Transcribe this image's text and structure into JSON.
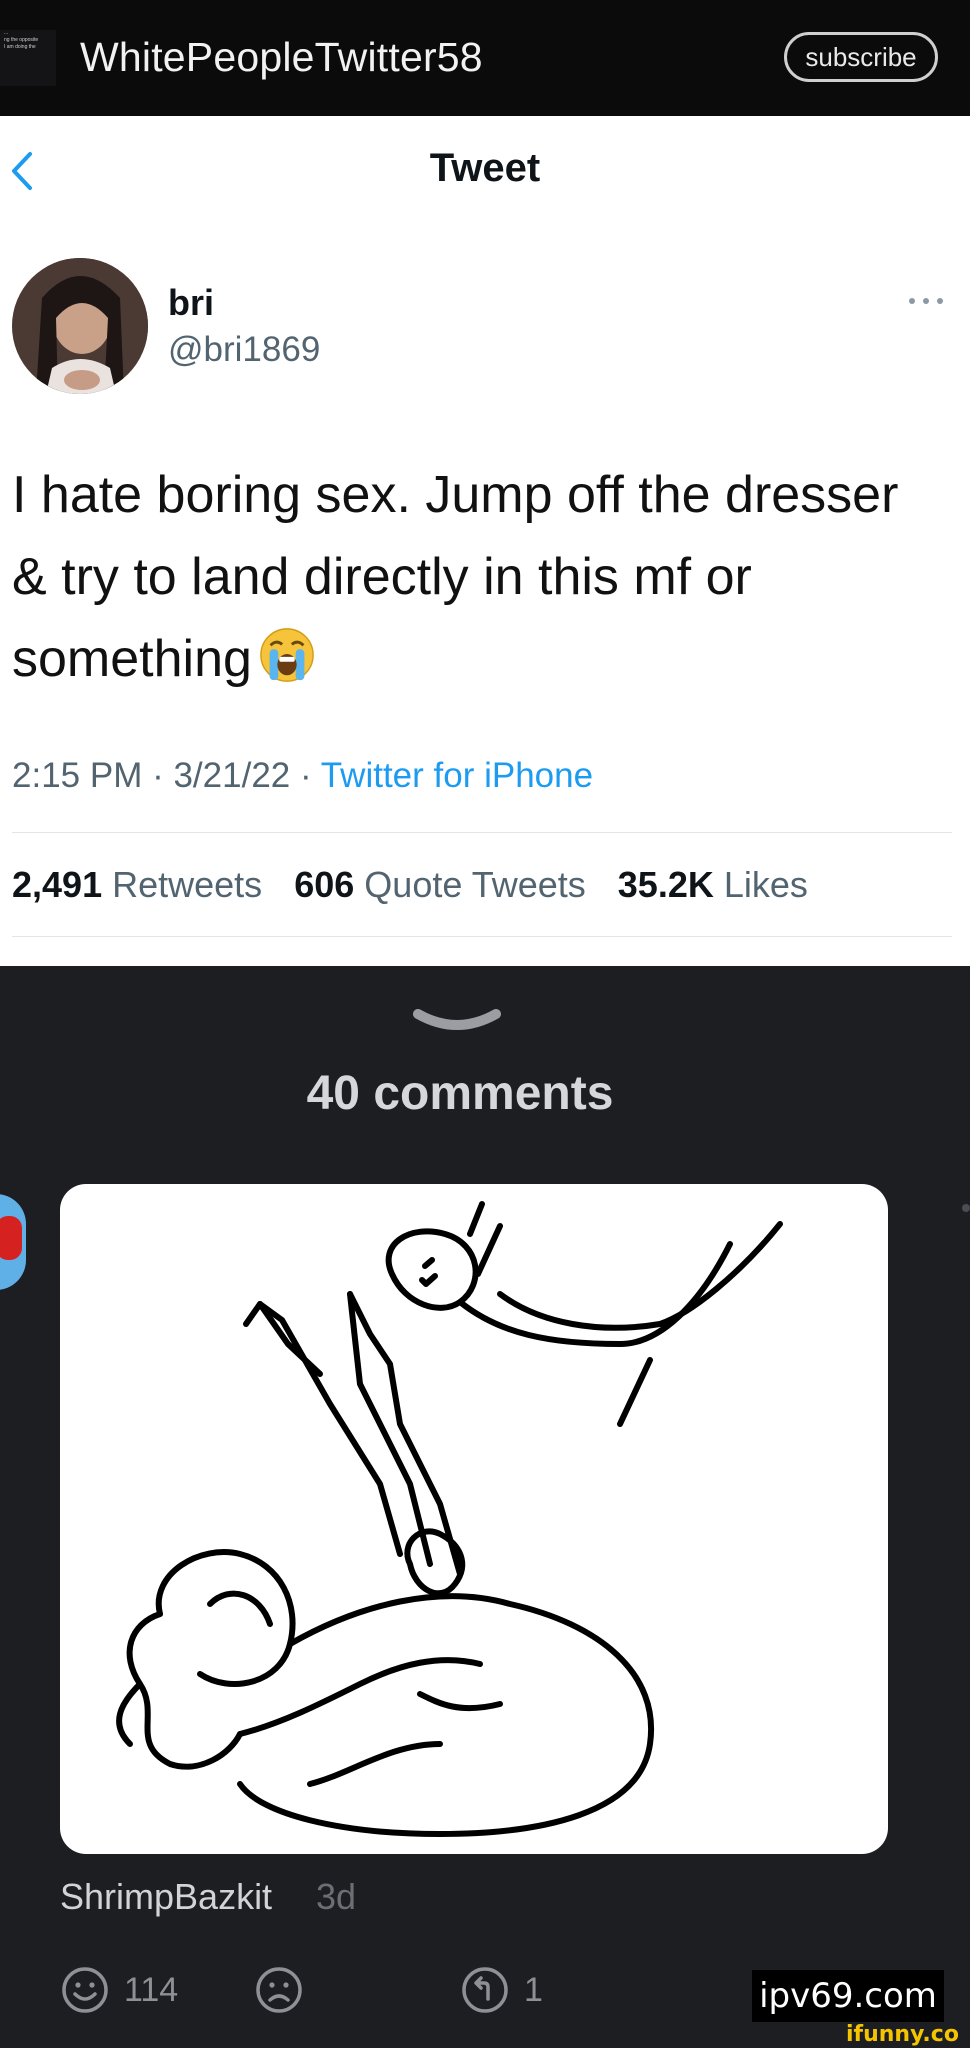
{
  "topbar": {
    "subreddit_name": "WhitePeopleTwitter58",
    "subscribe_label": "subscribe",
    "icon_thumbnail_lines": [
      "...",
      "ng the opposite",
      "I am doing the"
    ]
  },
  "tweet": {
    "header_title": "Tweet",
    "display_name": "bri",
    "handle": "@bri1869",
    "text_lines": [
      "I hate boring sex. Jump off the dresser",
      "& try to land directly in this mf or",
      "something"
    ],
    "emoji": "loudly-crying-face",
    "time": "2:15 PM",
    "date": "3/21/22",
    "source": "Twitter for iPhone",
    "stats": [
      {
        "value": "2,491",
        "label": "Retweets"
      },
      {
        "value": "606",
        "label": "Quote Tweets"
      },
      {
        "value": "35.2K",
        "label": "Likes"
      }
    ]
  },
  "comments": {
    "count_label": "40 comments",
    "items": [
      {
        "author": "ShrimpBazkit",
        "age": "3d",
        "likes": "114",
        "replies": "1"
      }
    ]
  },
  "watermark": {
    "site": "ipv69.com",
    "brand": "ifunny.co"
  },
  "colors": {
    "topbar_bg": "#0b0b0c",
    "tweet_bg": "#ffffff",
    "panel_bg": "#1d1e22",
    "link_blue": "#1d9bf0",
    "muted_gray": "#536471"
  }
}
